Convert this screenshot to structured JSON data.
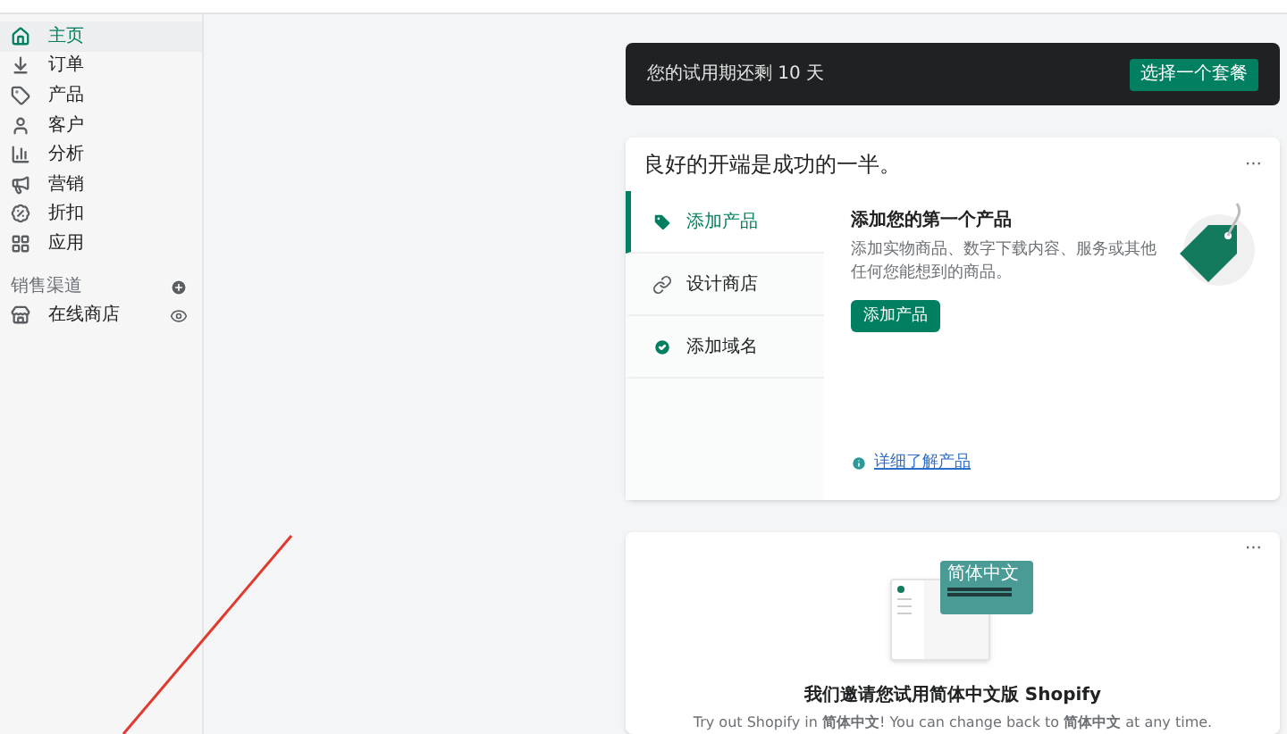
{
  "sidebar": {
    "items": [
      {
        "label": "主页",
        "kind": "home",
        "selected": true
      },
      {
        "label": "订单",
        "kind": "orders",
        "selected": false
      },
      {
        "label": "产品",
        "kind": "products",
        "selected": false
      },
      {
        "label": "客户",
        "kind": "customers",
        "selected": false
      },
      {
        "label": "分析",
        "kind": "analytics",
        "selected": false
      },
      {
        "label": "营销",
        "kind": "marketing",
        "selected": false
      },
      {
        "label": "折扣",
        "kind": "discounts",
        "selected": false
      },
      {
        "label": "应用",
        "kind": "apps",
        "selected": false
      }
    ],
    "section_title": "销售渠道",
    "channels": [
      {
        "label": "在线商店"
      }
    ]
  },
  "trial_banner": {
    "text": "您的试用期还剩 10 天",
    "button": "选择一个套餐"
  },
  "setup_card": {
    "title": "良好的开端是成功的一半。",
    "menu": "···",
    "tabs": [
      {
        "label": "添加产品",
        "kind": "tag",
        "selected": true
      },
      {
        "label": "设计商店",
        "kind": "link",
        "selected": false
      },
      {
        "label": "添加域名",
        "kind": "done",
        "selected": false
      }
    ],
    "heading": "添加您的第一个产品",
    "description": "添加实物商品、数字下载内容、服务或其他任何您能想到的商品。",
    "button": "添加产品",
    "link": "详细了解产品"
  },
  "language_card": {
    "menu": "···",
    "illustration_label": "简体中文",
    "title": "我们邀请您试用简体中文版 Shopify",
    "body": "Try out Shopify in **简体中文**! You can change back to **简体中文** at any time."
  }
}
